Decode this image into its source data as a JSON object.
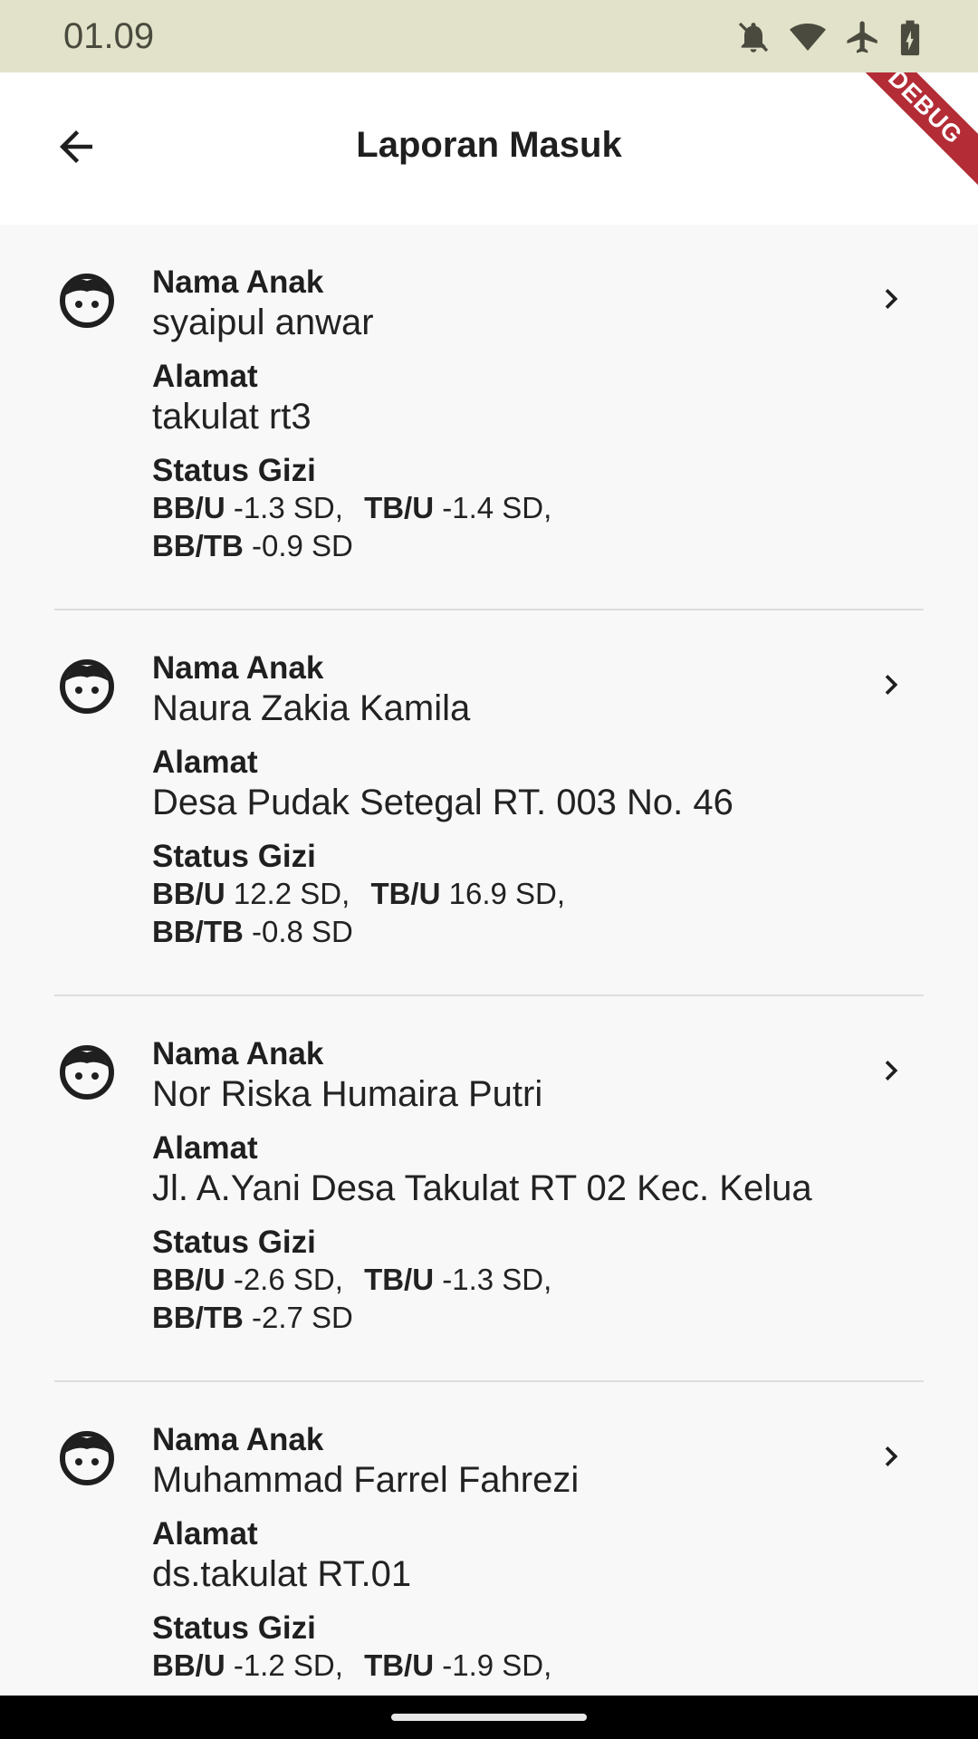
{
  "status_bar": {
    "time": "01.09",
    "icons": [
      "notifications-off-icon",
      "wifi-icon",
      "airplane-icon",
      "battery-charging-icon"
    ]
  },
  "app_bar": {
    "title": "Laporan Masuk",
    "back_icon": "arrow-back-icon",
    "debug_banner": "DEBUG"
  },
  "reports": [
    {
      "name_label": "Nama Anak",
      "name": "syaipul anwar",
      "address_label": "Alamat",
      "address": "takulat rt3",
      "status_label": "Status Gizi",
      "bbu_key": "BB/U",
      "bbu": "-1.3 SD,",
      "tbu_key": "TB/U",
      "tbu": "-1.4 SD,",
      "bbtb_key": "BB/TB",
      "bbtb": "-0.9 SD"
    },
    {
      "name_label": "Nama Anak",
      "name": "Naura Zakia Kamila",
      "address_label": "Alamat",
      "address": "Desa Pudak Setegal RT. 003 No. 46",
      "status_label": "Status Gizi",
      "bbu_key": "BB/U",
      "bbu": "12.2 SD,",
      "tbu_key": "TB/U",
      "tbu": "16.9 SD,",
      "bbtb_key": "BB/TB",
      "bbtb": "-0.8 SD"
    },
    {
      "name_label": "Nama Anak",
      "name": "Nor Riska Humaira Putri",
      "address_label": "Alamat",
      "address": "Jl. A.Yani Desa Takulat RT 02 Kec. Kelua",
      "status_label": "Status Gizi",
      "bbu_key": "BB/U",
      "bbu": "-2.6 SD,",
      "tbu_key": "TB/U",
      "tbu": "-1.3 SD,",
      "bbtb_key": "BB/TB",
      "bbtb": "-2.7 SD"
    },
    {
      "name_label": "Nama Anak",
      "name": "Muhammad Farrel Fahrezi",
      "address_label": "Alamat",
      "address": "ds.takulat RT.01",
      "status_label": "Status Gizi",
      "bbu_key": "BB/U",
      "bbu": "-1.2 SD,",
      "tbu_key": "TB/U",
      "tbu": "-1.9 SD,",
      "bbtb_key": "",
      "bbtb": ""
    }
  ]
}
